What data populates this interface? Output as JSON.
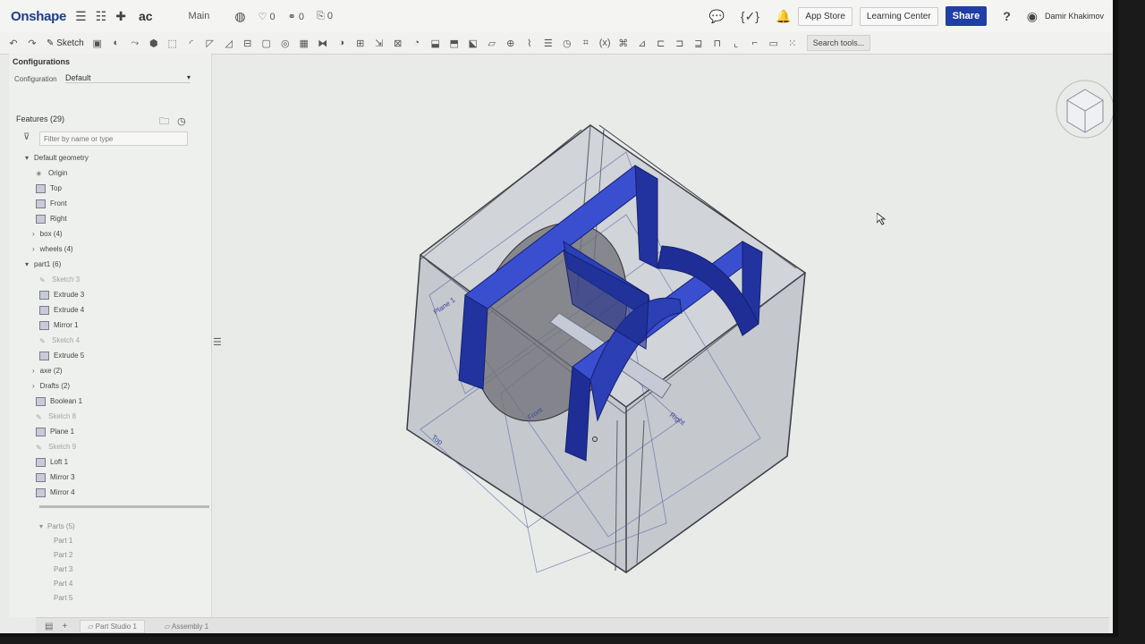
{
  "app": {
    "name": "Onshape",
    "doc_name": "ac",
    "branch": "Main"
  },
  "topbar": {
    "likes": "0",
    "links": "0",
    "copies": "0",
    "app_store": "App Store",
    "learning_center": "Learning Center",
    "share": "Share",
    "help": "?",
    "user": "Damir Khakimov"
  },
  "toolbar": {
    "sketch": "Sketch",
    "search_tools": "Search tools..."
  },
  "configurations": {
    "title": "Configurations",
    "label": "Configuration",
    "value": "Default"
  },
  "features": {
    "header": "Features (29)",
    "filter_placeholder": "Filter by name or type",
    "items": [
      {
        "label": "Default geometry",
        "type": "group"
      },
      {
        "label": "Origin",
        "type": "origin"
      },
      {
        "label": "Top",
        "type": "plane"
      },
      {
        "label": "Front",
        "type": "plane"
      },
      {
        "label": "Right",
        "type": "plane"
      },
      {
        "label": "box (4)",
        "type": "folder"
      },
      {
        "label": "wheels (4)",
        "type": "folder"
      },
      {
        "label": "part1 (6)",
        "type": "group"
      },
      {
        "label": "Sketch 3",
        "type": "sketch"
      },
      {
        "label": "Extrude 3",
        "type": "feature"
      },
      {
        "label": "Extrude 4",
        "type": "feature"
      },
      {
        "label": "Mirror 1",
        "type": "feature"
      },
      {
        "label": "Sketch 4",
        "type": "sketch"
      },
      {
        "label": "Extrude 5",
        "type": "feature"
      },
      {
        "label": "axe (2)",
        "type": "folder"
      },
      {
        "label": "Drafts (2)",
        "type": "folder"
      },
      {
        "label": "Boolean 1",
        "type": "feature"
      },
      {
        "label": "Sketch 8",
        "type": "sketch"
      },
      {
        "label": "Plane 1",
        "type": "plane"
      },
      {
        "label": "Sketch 9",
        "type": "sketch"
      },
      {
        "label": "Loft 1",
        "type": "feature"
      },
      {
        "label": "Mirror 3",
        "type": "feature"
      },
      {
        "label": "Mirror 4",
        "type": "feature"
      }
    ]
  },
  "parts": {
    "header": "Parts (5)",
    "items": [
      "Part 1",
      "Part 2",
      "Part 3",
      "Part 4",
      "Part 5"
    ]
  },
  "tabs": [
    {
      "label": "Part Studio 1"
    },
    {
      "label": "Assembly 1"
    }
  ],
  "viewport": {
    "plane_labels": [
      "Plane 1",
      "Top",
      "Front",
      "Right"
    ],
    "colors": {
      "part": "#2c3fb5",
      "part_dark": "#1a2a86",
      "transparent_box": "#9fa3b0",
      "background": "#e9ebe8"
    }
  }
}
